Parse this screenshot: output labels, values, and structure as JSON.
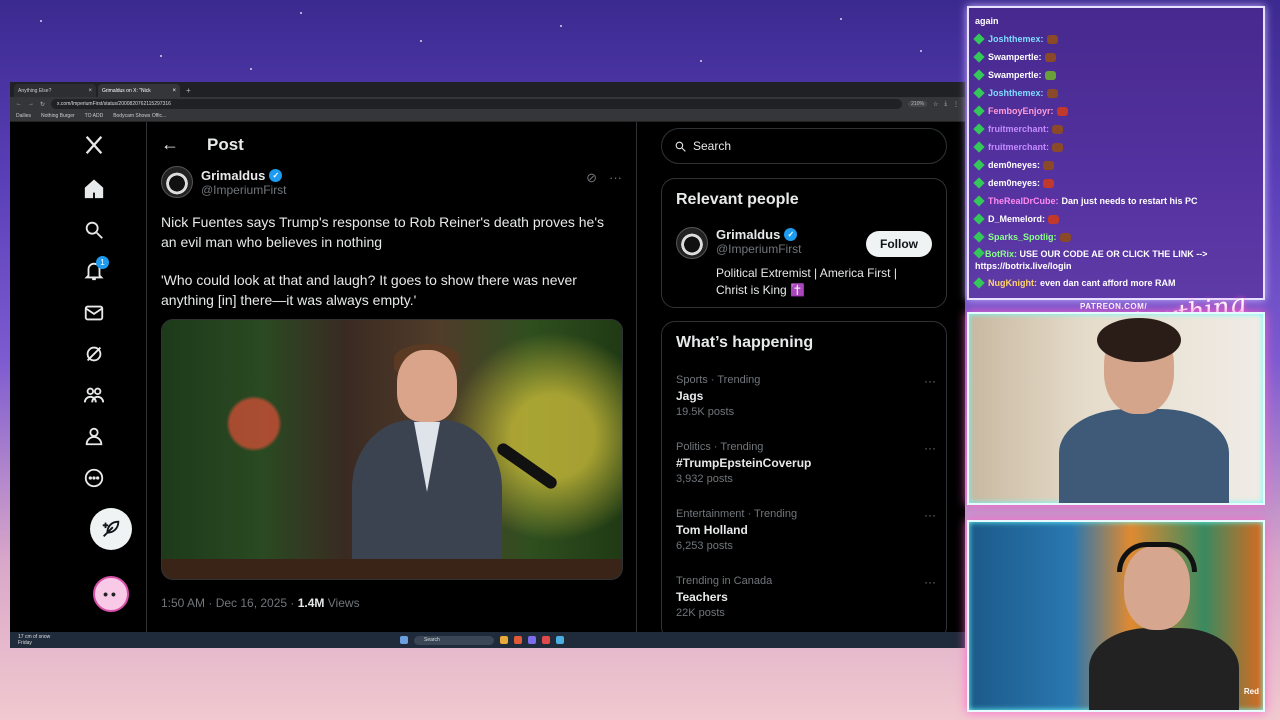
{
  "browser": {
    "tabs": [
      {
        "label": "Anything Else?",
        "active": false
      },
      {
        "label": "Grimaldus on X: \"Nick",
        "active": true
      }
    ],
    "url": "x.com/ImperiumFirst/status/2000820762115297316",
    "zoom": "210%",
    "bookmarks": [
      "Dailies",
      "Nothing Burger",
      "TO ADD",
      "Bodycam Shows Offic..."
    ]
  },
  "nav": {
    "notifications_count": "1"
  },
  "post": {
    "header": "Post",
    "author_name": "Grimaldus",
    "author_handle": "@ImperiumFirst",
    "text1": "Nick Fuentes says Trump's response to Rob Reiner's death proves he's an evil man who believes in nothing",
    "text2": "'Who could look at that and laugh? It goes to show there was never anything [in] there—it was always empty.'",
    "timestamp": "1:50 AM · Dec 16, 2025 · ",
    "views_count": "1.4M",
    "views_label": " Views"
  },
  "sidebar": {
    "search_placeholder": "Search",
    "relevant_title": "Relevant people",
    "person_name": "Grimaldus",
    "person_handle": "@ImperiumFirst",
    "person_bio": "Political Extremist | America First | Christ is King ✝️",
    "follow_label": "Follow",
    "happening_title": "What’s happening",
    "trends": [
      {
        "category": "Sports · Trending",
        "name": "Jags",
        "count": "19.5K posts"
      },
      {
        "category": "Politics · Trending",
        "name": "#TrumpEpsteinCoverup",
        "count": "3,932 posts"
      },
      {
        "category": "Entertainment · Trending",
        "name": "Tom Holland",
        "count": "6,253 posts"
      },
      {
        "category": "Trending in Canada",
        "name": "Teachers",
        "count": "22K posts"
      }
    ]
  },
  "taskbar": {
    "weather_temp": "17 cm of snow",
    "weather_day": "Friday",
    "search": "Search"
  },
  "chat": {
    "top_line": "again",
    "messages": [
      {
        "user": "Joshthemex:",
        "msg": "",
        "color": "#7fdcff"
      },
      {
        "user": "Swampertle:",
        "msg": "",
        "color": "#ffffff"
      },
      {
        "user": "Swampertle:",
        "msg": "",
        "color": "#ffffff"
      },
      {
        "user": "Joshthemex:",
        "msg": "",
        "color": "#7fdcff"
      },
      {
        "user": "FemboyEnjoyr:",
        "msg": "",
        "color": "#ff9ad5"
      },
      {
        "user": "fruitmerchant:",
        "msg": "",
        "color": "#c48bff"
      },
      {
        "user": "fruitmerchant:",
        "msg": "",
        "color": "#c48bff"
      },
      {
        "user": "dem0neyes:",
        "msg": "",
        "color": "#ffffff"
      },
      {
        "user": "dem0neyes:",
        "msg": "",
        "color": "#ffffff"
      },
      {
        "user": "TheRealDrCube:",
        "msg": "Dan just needs to restart his PC",
        "color": "#ff8af0"
      },
      {
        "user": "D_Memelord:",
        "msg": "",
        "color": "#ffffff"
      },
      {
        "user": "Sparks_Spotlig:",
        "msg": "",
        "color": "#8aff8a"
      }
    ],
    "bot_user": "BotRix:",
    "bot_msg": "USE OUR CODE AE OR CLICK THE LINK --> https://botrix.live/login",
    "last_user": "NugKnight:",
    "last_msg": "even dan cant afford more RAM"
  },
  "overlay": {
    "patreon": "PATREON.COM/",
    "logo": "Anything Else?",
    "cam_label": "Red"
  }
}
